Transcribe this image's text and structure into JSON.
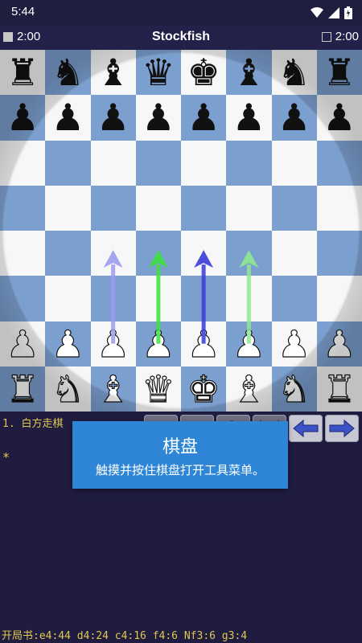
{
  "status_bar": {
    "time": "5:44",
    "icons": [
      "wifi-icon",
      "signal-icon",
      "battery-icon"
    ]
  },
  "title_bar": {
    "title": "Stockfish",
    "white_clock": "2:00",
    "black_clock": "2:00"
  },
  "board": {
    "light_color": "#f7f7f7",
    "dark_color": "#7b9fcf",
    "ranks": [
      [
        "r",
        "n",
        "b",
        "q",
        "k",
        "b",
        "n",
        "r"
      ],
      [
        "p",
        "p",
        "p",
        "p",
        "p",
        "p",
        "p",
        "p"
      ],
      [
        "",
        "",
        "",
        "",
        "",
        "",
        "",
        ""
      ],
      [
        "",
        "",
        "",
        "",
        "",
        "",
        "",
        ""
      ],
      [
        "",
        "",
        "",
        "",
        "",
        "",
        "",
        ""
      ],
      [
        "",
        "",
        "",
        "",
        "",
        "",
        "",
        ""
      ],
      [
        "P",
        "P",
        "P",
        "P",
        "P",
        "P",
        "P",
        "P"
      ],
      [
        "R",
        "N",
        "B",
        "Q",
        "K",
        "B",
        "N",
        "R"
      ]
    ],
    "hint_arrows": [
      {
        "from": "c2",
        "to": "c4",
        "color": "#9b9bf0"
      },
      {
        "from": "d2",
        "to": "d4",
        "color": "#3ee03e"
      },
      {
        "from": "e2",
        "to": "e4",
        "color": "#3a3ad8"
      },
      {
        "from": "f2",
        "to": "f4",
        "color": "#8ee88e"
      }
    ]
  },
  "moves": {
    "line1": "1. 白方走棋",
    "line2": "*"
  },
  "toolbar": {
    "buttons": [
      "mode-icon",
      "flip-board-icon",
      "search-icon",
      "menu-icon",
      "back-arrow-icon",
      "forward-arrow-icon"
    ]
  },
  "tooltip": {
    "title": "棋盘",
    "body": "触摸并按住棋盘打开工具菜单。"
  },
  "book": {
    "text": "开局书:e4:44 d4:24 c4:16 f4:6 Nf3:6 g3:4"
  }
}
